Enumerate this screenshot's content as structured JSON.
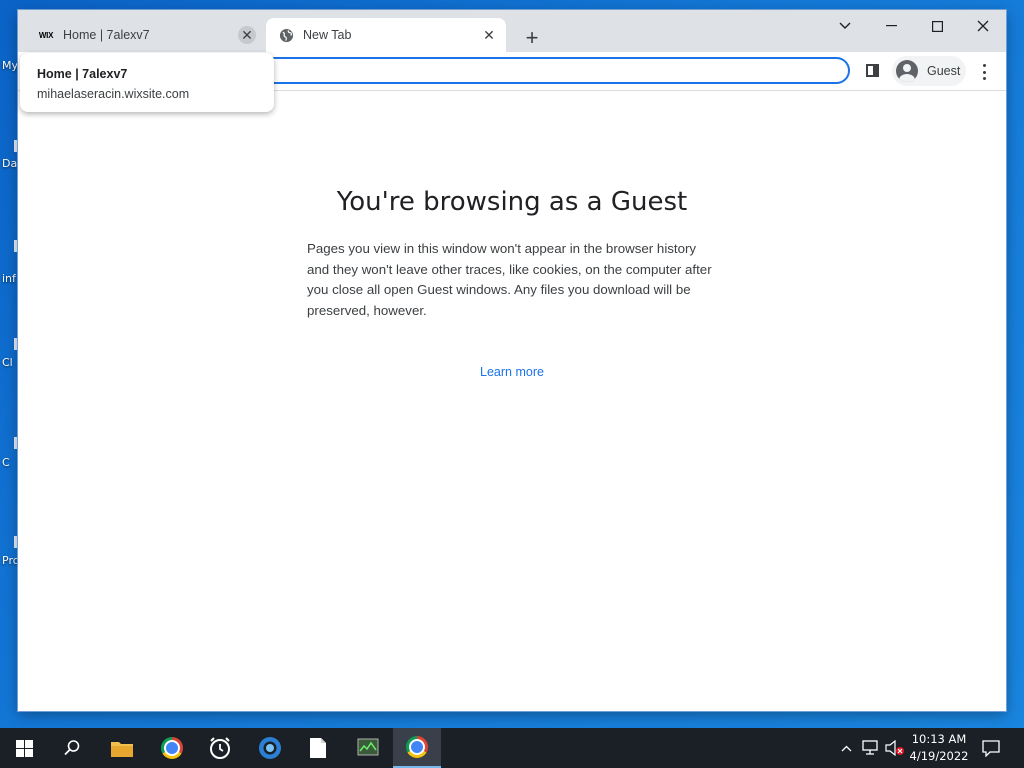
{
  "desktop": {
    "icon_labels": [
      "My",
      "Da",
      "inf",
      "Cl",
      "C",
      "Pro"
    ]
  },
  "browser": {
    "tabs": [
      {
        "title": "Home | 7alexv7",
        "favicon": "wix-icon",
        "favicon_text": "WIX",
        "close": "✕"
      },
      {
        "title": "New Tab",
        "favicon": "globe-icon",
        "close": "✕"
      }
    ],
    "new_tab_symbol": "+",
    "window_controls": {
      "tab_search": "chevron-down-icon",
      "minimize": "minimize-icon",
      "maximize": "maximize-icon",
      "close": "close-icon"
    },
    "profile_label": "Guest",
    "omnibox_value": ""
  },
  "hover_card": {
    "title": "Home | 7alexv7",
    "url": "mihaelaseracin.wixsite.com"
  },
  "page": {
    "heading": "You're browsing as a Guest",
    "description": "Pages you view in this window won't appear in the browser history and they won't leave other traces, like cookies, on the computer after you close all open Guest windows. Any files you download will be preserved, however.",
    "learn_more": "Learn more"
  },
  "taskbar": {
    "clock_time": "10:13 AM",
    "clock_date": "4/19/2022",
    "accent": "#76b9ed"
  },
  "colors": {
    "link": "#1a73e8",
    "tabstrip": "#dee1e6",
    "desktop": "#1479d8"
  }
}
